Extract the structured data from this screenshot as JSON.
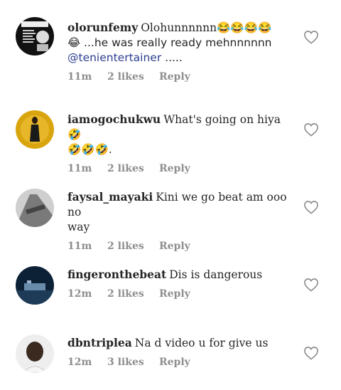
{
  "comments": [
    {
      "username": "olorunfemy",
      "text_a": "Olohunnnnnn😂😂😂😂",
      "text_b": "😂 ...he was really ready mehnnnnnn",
      "mention": "@tenientertainer",
      "text_c": " .....",
      "time": "11m",
      "likes": "2 likes",
      "reply": "Reply",
      "avatar_color": "#1a1a1a"
    },
    {
      "username": "iamogochukwu",
      "text_a": "What's going on hiya 🤣",
      "text_b": "🤣🤣🤣.",
      "time": "11m",
      "likes": "2 likes",
      "reply": "Reply",
      "avatar_color": "#c8960a"
    },
    {
      "username": "faysal_mayaki",
      "text_a": "Kini we go beat am ooo no",
      "text_b": "way",
      "time": "11m",
      "likes": "2 likes",
      "reply": "Reply",
      "avatar_color": "#9a9a9a"
    },
    {
      "username": "fingeronthebeat",
      "text_a": "Dis is dangerous",
      "time": "12m",
      "likes": "2 likes",
      "reply": "Reply",
      "avatar_color": "#0e2740"
    },
    {
      "username": "dbntriplea",
      "text_a": "Na d video u for give us",
      "time": "12m",
      "likes": "3 likes",
      "reply": "Reply",
      "avatar_color": "#e8e8e8"
    }
  ]
}
